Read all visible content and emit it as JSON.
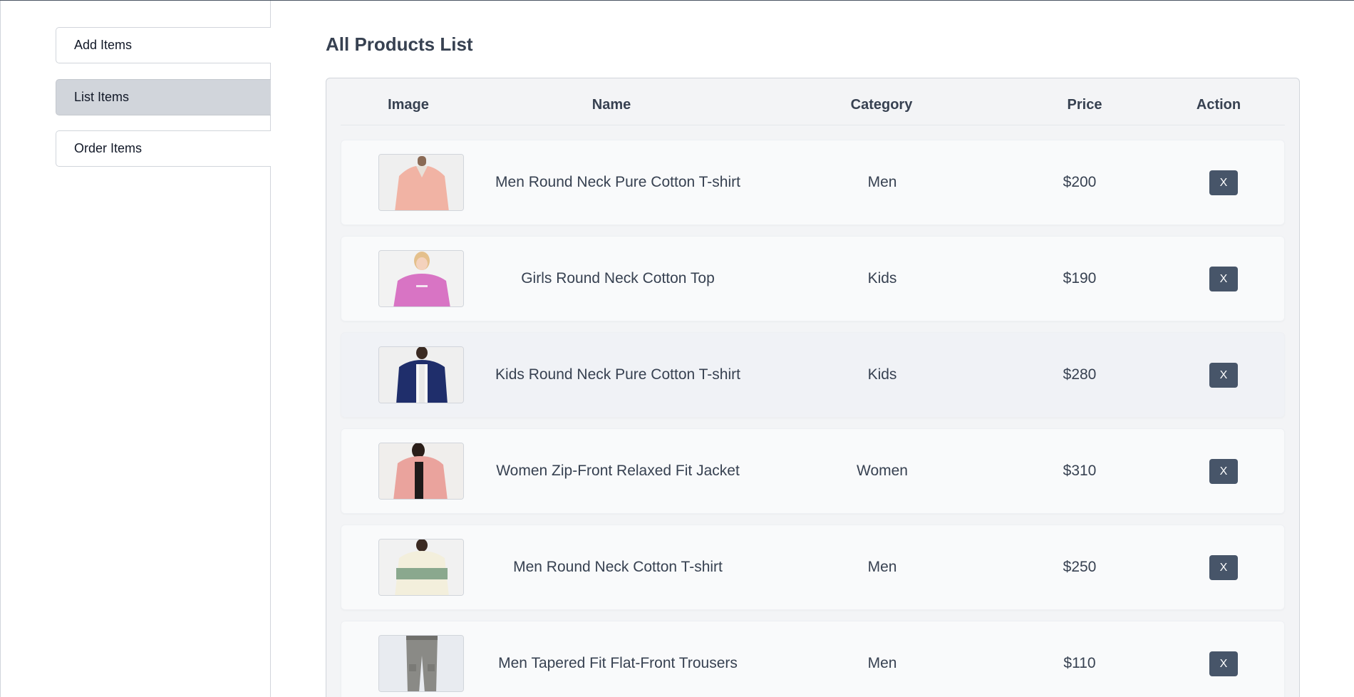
{
  "sidebar": {
    "items": [
      {
        "label": "Add Items",
        "active": false
      },
      {
        "label": "List Items",
        "active": true
      },
      {
        "label": "Order Items",
        "active": false
      }
    ]
  },
  "main": {
    "title": "All Products List",
    "columns": [
      "Image",
      "Name",
      "Category",
      "Price",
      "Action"
    ],
    "rows": [
      {
        "name": "Men Round Neck Pure Cotton T-shirt",
        "category": "Men",
        "price": "$200",
        "action": "X",
        "image_icon": "pink-shirt-photo"
      },
      {
        "name": "Girls Round Neck Cotton Top",
        "category": "Kids",
        "price": "$190",
        "action": "X",
        "image_icon": "pink-top-photo"
      },
      {
        "name": "Kids Round Neck Pure Cotton T-shirt",
        "category": "Kids",
        "price": "$280",
        "action": "X",
        "image_icon": "navy-shirt-photo"
      },
      {
        "name": "Women Zip-Front Relaxed Fit Jacket",
        "category": "Women",
        "price": "$310",
        "action": "X",
        "image_icon": "pink-jacket-photo"
      },
      {
        "name": "Men Round Neck Cotton T-shirt",
        "category": "Men",
        "price": "$250",
        "action": "X",
        "image_icon": "striped-shirt-photo"
      },
      {
        "name": "Men Tapered Fit Flat-Front Trousers",
        "category": "Men",
        "price": "$110",
        "action": "X",
        "image_icon": "grey-trousers-photo"
      }
    ]
  },
  "colors": {
    "active_sidebar": "#d1d5db",
    "delete_button": "#475569",
    "table_bg": "#f3f4f6"
  }
}
